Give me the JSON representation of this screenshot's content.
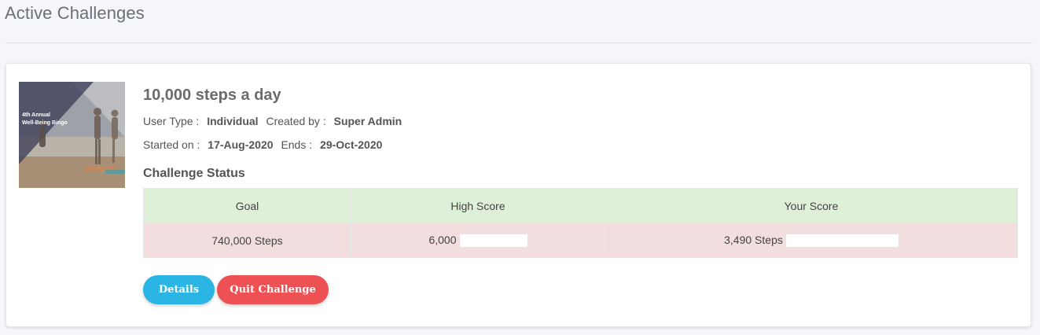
{
  "page": {
    "title": "Active Challenges"
  },
  "challenge": {
    "thumbnail_text": {
      "line1": "4th Annual",
      "line2": "Well-Being Bingo"
    },
    "title": "10,000 steps a day",
    "user_type_label": "User Type :",
    "user_type_value": "Individual",
    "created_by_label": "Created by :",
    "created_by_value": "Super Admin",
    "started_on_label": "Started on :",
    "started_on_value": "17-Aug-2020",
    "ends_label": "Ends :",
    "ends_value": "29-Oct-2020"
  },
  "status": {
    "heading": "Challenge Status",
    "columns": [
      "Goal",
      "High Score",
      "Your Score"
    ],
    "values": {
      "goal": "740,000 Steps",
      "high_score": "6,000",
      "your_score": "3,490 Steps"
    }
  },
  "actions": {
    "details_label": "Details",
    "quit_label": "Quit Challenge"
  },
  "colors": {
    "header_row": "#dff0d8",
    "value_row": "#f2dede",
    "details_button": "#2bb5e4",
    "quit_button": "#ee5153"
  }
}
